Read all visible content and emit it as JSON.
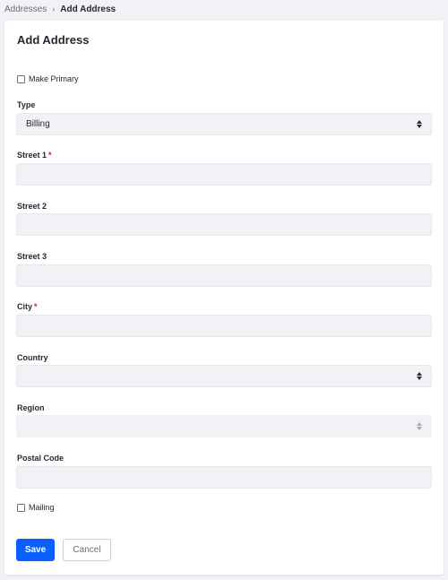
{
  "breadcrumb": {
    "parent": "Addresses",
    "separator": "›",
    "current": "Add Address"
  },
  "form": {
    "title": "Add Address",
    "make_primary_label": "Make Primary",
    "make_primary_checked": false,
    "type": {
      "label": "Type",
      "value": "Billing"
    },
    "street1": {
      "label": "Street 1",
      "required": "*",
      "value": ""
    },
    "street2": {
      "label": "Street 2",
      "value": ""
    },
    "street3": {
      "label": "Street 3",
      "value": ""
    },
    "city": {
      "label": "City",
      "required": "*",
      "value": ""
    },
    "country": {
      "label": "Country",
      "value": ""
    },
    "region": {
      "label": "Region",
      "value": ""
    },
    "postal_code": {
      "label": "Postal Code",
      "value": ""
    },
    "mailing_label": "Mailing",
    "mailing_checked": false
  },
  "actions": {
    "save_label": "Save",
    "cancel_label": "Cancel"
  },
  "colors": {
    "primary": "#0b5fff",
    "required": "#da1414",
    "input_bg": "#f1f2f5"
  }
}
